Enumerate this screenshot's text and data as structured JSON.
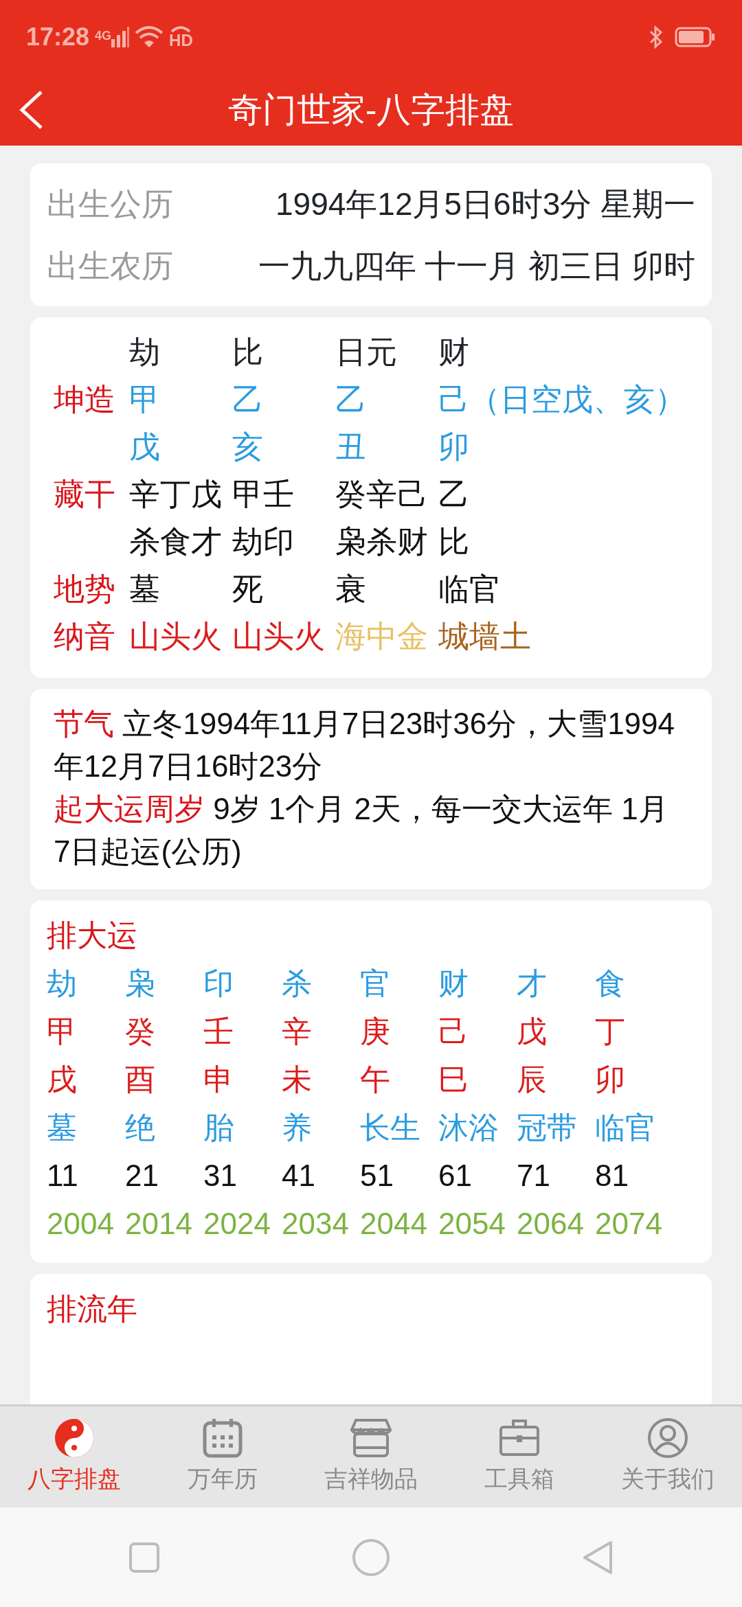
{
  "status_bar": {
    "time": "17:28",
    "network": "4G",
    "call": "HD"
  },
  "header": {
    "title": "奇门世家-八字排盘"
  },
  "birth": [
    {
      "label": "出生公历",
      "value": "1994年12月5日6时3分 星期一"
    },
    {
      "label": "出生农历",
      "value": "一九九四年 十一月 初三日 卯时"
    }
  ],
  "bazi": {
    "headers": [
      "劫",
      "比",
      "日元",
      "财"
    ],
    "rows": [
      {
        "label": "坤造",
        "cells": [
          {
            "text": "甲",
            "color": "#2b9be0"
          },
          {
            "text": "乙",
            "color": "#2b9be0"
          },
          {
            "text": "乙",
            "color": "#2b9be0"
          },
          {
            "text": "己（日空戊、亥）",
            "color": "#2b9be0"
          }
        ]
      },
      {
        "cells": [
          {
            "text": "戊",
            "color": "#2b9be0"
          },
          {
            "text": "亥",
            "color": "#2b9be0"
          },
          {
            "text": "丑",
            "color": "#2b9be0"
          },
          {
            "text": "卯",
            "color": "#2b9be0"
          }
        ]
      },
      {
        "label": "藏干",
        "cells": [
          {
            "text": "辛丁戊",
            "color": "#111111"
          },
          {
            "text": "甲壬",
            "color": "#111111"
          },
          {
            "text": "癸辛己",
            "color": "#111111"
          },
          {
            "text": "乙",
            "color": "#111111"
          }
        ]
      },
      {
        "cells": [
          {
            "text": "杀食才",
            "color": "#111111"
          },
          {
            "text": "劫印",
            "color": "#111111"
          },
          {
            "text": "枭杀财",
            "color": "#111111"
          },
          {
            "text": "比",
            "color": "#111111"
          }
        ]
      },
      {
        "label": "地势",
        "cells": [
          {
            "text": "墓",
            "color": "#111111"
          },
          {
            "text": "死",
            "color": "#111111"
          },
          {
            "text": "衰",
            "color": "#111111"
          },
          {
            "text": "临官",
            "color": "#111111"
          }
        ]
      },
      {
        "label": "纳音",
        "cells": [
          {
            "text": "山头火",
            "color": "#dd1c1c"
          },
          {
            "text": "山头火",
            "color": "#dd1c1c"
          },
          {
            "text": "海中金",
            "color": "#e8c064"
          },
          {
            "text": "城墙土",
            "color": "#a86420"
          }
        ]
      }
    ]
  },
  "jieqi": [
    {
      "label": "节气",
      "text": "立冬1994年11月7日23时36分，大雪1994年12月7日16时23分"
    },
    {
      "label": "起大运周岁",
      "text": "9岁 1个月 2天，每一交大运年 1月 7日起运(公历)"
    }
  ],
  "dayun": {
    "title": "排大运",
    "rows": [
      {
        "color": "#2b9be0",
        "cells": [
          "劫",
          "枭",
          "印",
          "杀",
          "官",
          "财",
          "才",
          "食"
        ]
      },
      {
        "color": "#dd1c1c",
        "cells": [
          "甲",
          "癸",
          "壬",
          "辛",
          "庚",
          "己",
          "戊",
          "丁"
        ]
      },
      {
        "color": "#dd1c1c",
        "cells": [
          "戌",
          "酉",
          "申",
          "未",
          "午",
          "巳",
          "辰",
          "卯"
        ]
      },
      {
        "color": "#2b9be0",
        "cells": [
          "墓",
          "绝",
          "胎",
          "养",
          "长生",
          "沐浴",
          "冠带",
          "临官"
        ]
      },
      {
        "color": "#111111",
        "cells": [
          "11",
          "21",
          "31",
          "41",
          "51",
          "61",
          "71",
          "81"
        ]
      },
      {
        "color": "#7cb342",
        "cells": [
          "2004",
          "2014",
          "2024",
          "2034",
          "2044",
          "2054",
          "2064",
          "2074"
        ]
      }
    ]
  },
  "liunian": {
    "title": "排流年"
  },
  "tabs": [
    {
      "label": "八字排盘",
      "kind": "yinyang",
      "selected": true
    },
    {
      "label": "万年历",
      "kind": "calendar",
      "selected": false
    },
    {
      "label": "吉祥物品",
      "kind": "store",
      "selected": false
    },
    {
      "label": "工具箱",
      "kind": "briefcase",
      "selected": false
    },
    {
      "label": "关于我们",
      "kind": "user",
      "selected": false
    }
  ]
}
